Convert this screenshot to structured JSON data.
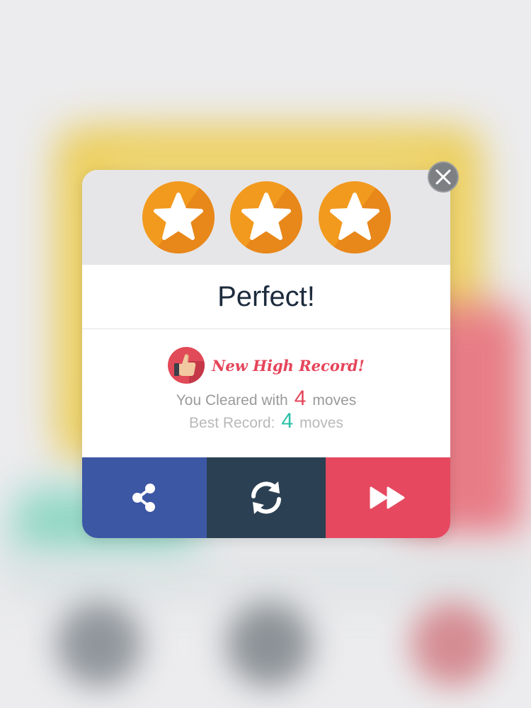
{
  "dialog": {
    "stars_earned": 3,
    "star_color": "#f29a1e",
    "title": "Perfect!",
    "record_badge_icon": "thumbs-up-icon",
    "record_label": "New High Record!",
    "cleared": {
      "prefix": "You Cleared with",
      "value": "4",
      "suffix": "moves"
    },
    "best": {
      "prefix": "Best Record:",
      "value": "4",
      "suffix": "moves"
    }
  },
  "buttons": {
    "share": {
      "icon": "share-icon",
      "color": "#3c57a4"
    },
    "retry": {
      "icon": "refresh-icon",
      "color": "#2b4153"
    },
    "next": {
      "icon": "fast-forward-icon",
      "color": "#e6495f"
    }
  },
  "close_button": {
    "icon": "close-icon"
  },
  "colors": {
    "accent_red": "#e5455a",
    "accent_teal": "#2bc0a8",
    "title_text": "#1d2b3d"
  }
}
